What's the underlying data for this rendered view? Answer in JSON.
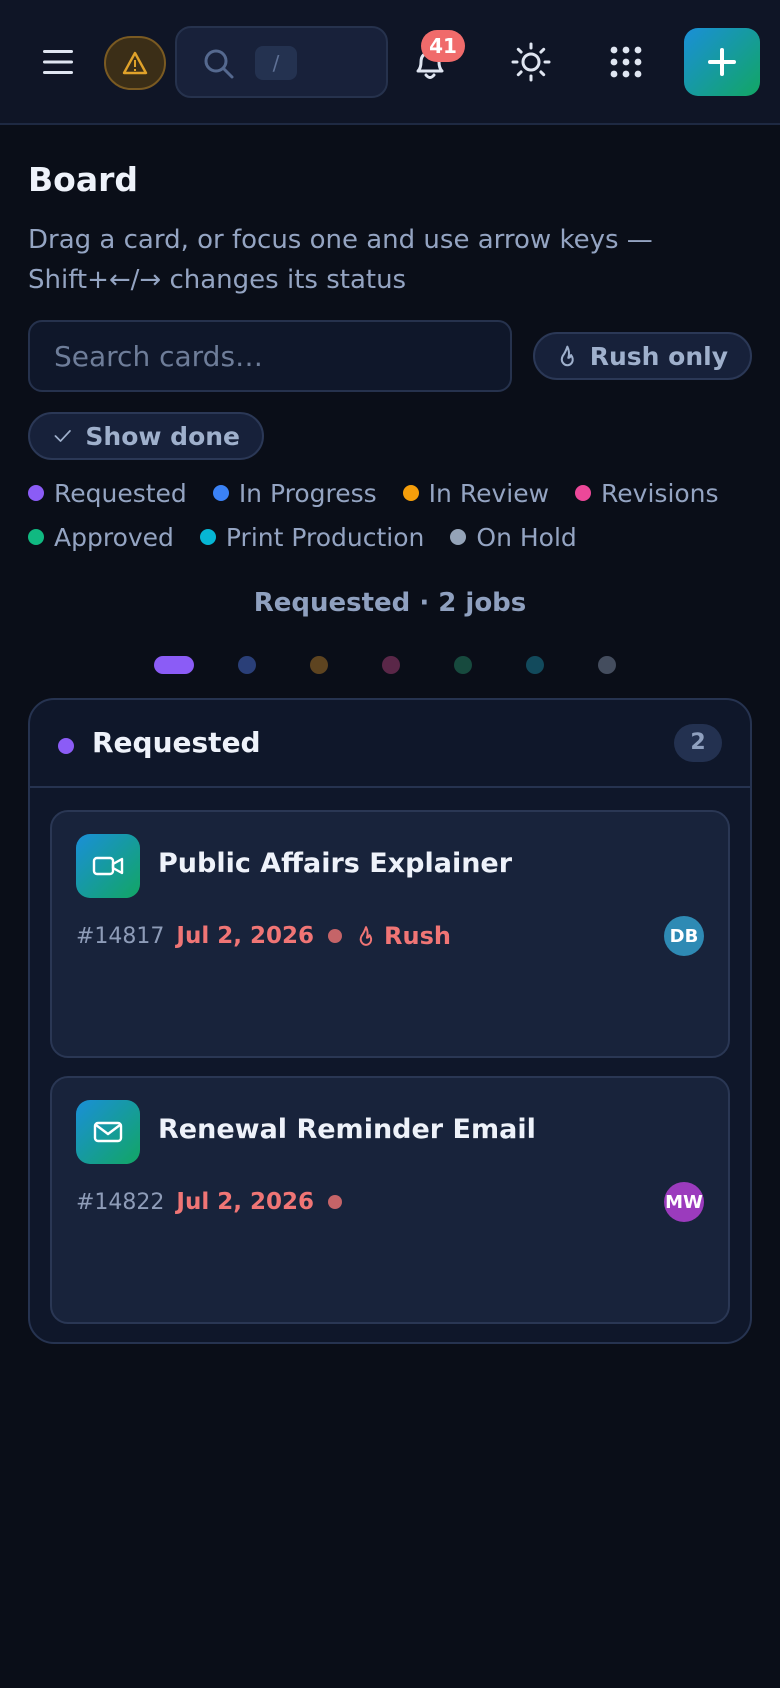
{
  "header": {
    "notifications_count": "41",
    "search_shortcut": "/"
  },
  "colors": {
    "accent_gradient_start": "#1a8fd8",
    "accent_gradient_end": "#12a664",
    "warning": "#e0a22a",
    "rush": "#f07575",
    "badge": "#f06b6b"
  },
  "icons": {
    "menu": "hamburger-icon",
    "warning": "warning-triangle-icon",
    "search": "search-icon",
    "notifications": "bell-icon",
    "theme": "sun-icon",
    "apps": "grid-icon",
    "add": "plus-icon",
    "rush": "flame-icon",
    "done": "check-icon"
  },
  "board": {
    "title": "Board",
    "help": "Drag a card, or focus one and use arrow keys — Shift+←/→ changes its status",
    "search_placeholder": "Search cards…",
    "rush_filter_label": "Rush only",
    "show_done_label": "Show done"
  },
  "legend": [
    {
      "label": "Requested",
      "color": "#8b5cf6"
    },
    {
      "label": "In Progress",
      "color": "#3b82f6"
    },
    {
      "label": "In Review",
      "color": "#f59e0b"
    },
    {
      "label": "Revisions",
      "color": "#ec4899"
    },
    {
      "label": "Approved",
      "color": "#10b981"
    },
    {
      "label": "Print Production",
      "color": "#06b6d4"
    },
    {
      "label": "On Hold",
      "color": "#94a3b8"
    }
  ],
  "summary": "Requested · 2 jobs",
  "pager": {
    "active_index": 0,
    "dots": [
      "#8b5cf6",
      "#2a3f78",
      "#5e4420",
      "#5a2748",
      "#174a3e",
      "#124a5c",
      "#444d5e"
    ]
  },
  "column": {
    "name": "Requested",
    "color": "#8b5cf6",
    "count": "2",
    "cards": [
      {
        "title": "Public Affairs Explainer",
        "id": "#14817",
        "date": "Jul 2, 2026",
        "rush": true,
        "rush_label": "Rush",
        "icon": "video-icon",
        "assignee": "DB",
        "assignee_color": "#2e8ab4"
      },
      {
        "title": "Renewal Reminder Email",
        "id": "#14822",
        "date": "Jul 2, 2026",
        "rush": false,
        "rush_label": "",
        "icon": "mail-icon",
        "assignee": "MW",
        "assignee_color": "#9b3bbd"
      }
    ]
  }
}
